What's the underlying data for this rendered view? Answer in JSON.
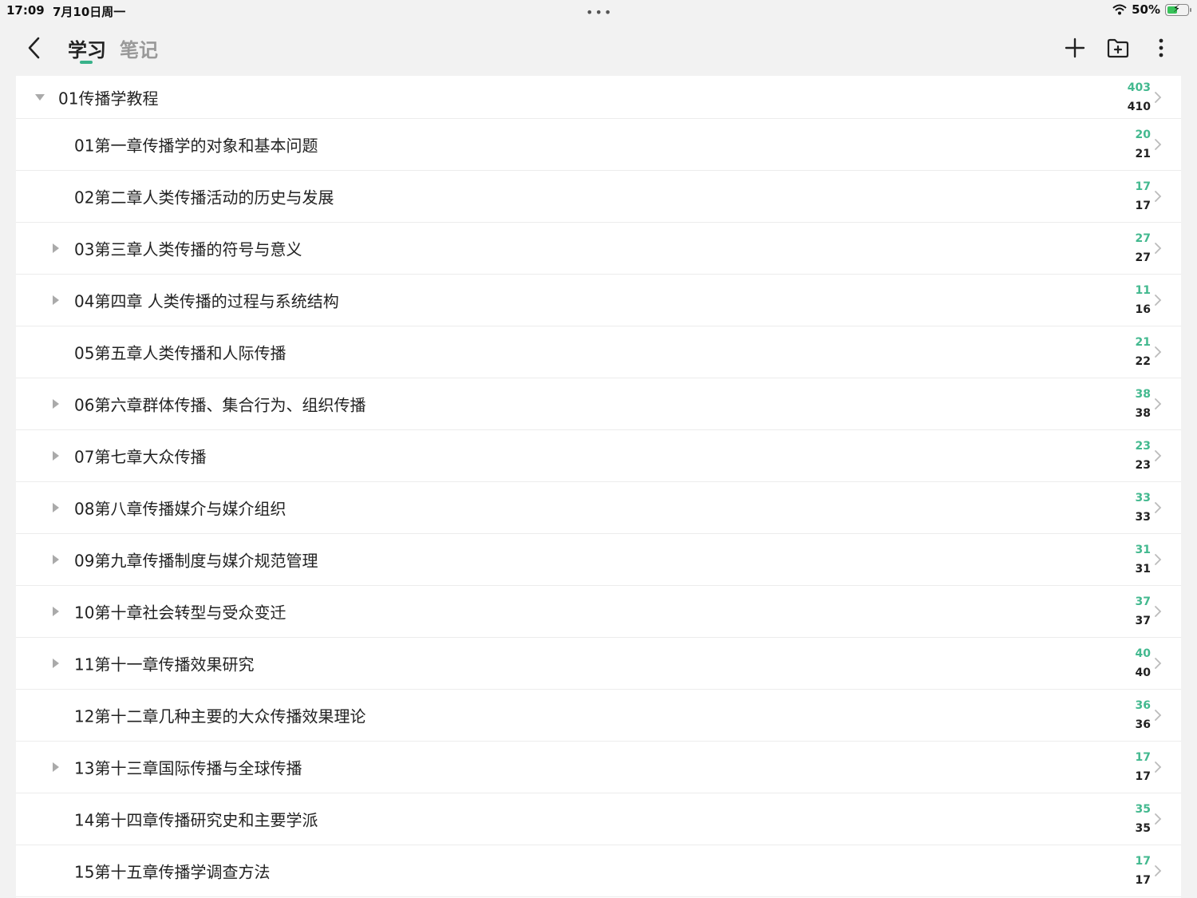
{
  "status_bar": {
    "time": "17:09",
    "date": "7月10日周一",
    "battery": "50%"
  },
  "nav": {
    "tabs": [
      {
        "label": "学习",
        "active": true
      },
      {
        "label": "笔记",
        "active": false
      }
    ],
    "accent_color": "#38b28a"
  },
  "root": {
    "title": "01传播学教程",
    "done": "403",
    "total": "410",
    "expanded": true
  },
  "chapters": [
    {
      "title": "01第一章传播学的对象和基本问题",
      "done": "20",
      "total": "21",
      "has_children": false
    },
    {
      "title": "02第二章人类传播活动的历史与发展",
      "done": "17",
      "total": "17",
      "has_children": false
    },
    {
      "title": "03第三章人类传播的符号与意义",
      "done": "27",
      "total": "27",
      "has_children": true
    },
    {
      "title": "04第四章 人类传播的过程与系统结构",
      "done": "11",
      "total": "16",
      "has_children": true
    },
    {
      "title": "05第五章人类传播和人际传播",
      "done": "21",
      "total": "22",
      "has_children": false
    },
    {
      "title": "06第六章群体传播、集合行为、组织传播",
      "done": "38",
      "total": "38",
      "has_children": true
    },
    {
      "title": "07第七章大众传播",
      "done": "23",
      "total": "23",
      "has_children": true
    },
    {
      "title": "08第八章传播媒介与媒介组织",
      "done": "33",
      "total": "33",
      "has_children": true
    },
    {
      "title": "09第九章传播制度与媒介规范管理",
      "done": "31",
      "total": "31",
      "has_children": true
    },
    {
      "title": "10第十章社会转型与受众变迁",
      "done": "37",
      "total": "37",
      "has_children": true
    },
    {
      "title": "11第十一章传播效果研究",
      "done": "40",
      "total": "40",
      "has_children": true
    },
    {
      "title": "12第十二章几种主要的大众传播效果理论",
      "done": "36",
      "total": "36",
      "has_children": false
    },
    {
      "title": "13第十三章国际传播与全球传播",
      "done": "17",
      "total": "17",
      "has_children": true
    },
    {
      "title": "14第十四章传播研究史和主要学派",
      "done": "35",
      "total": "35",
      "has_children": false
    },
    {
      "title": "15第十五章传播学调查方法",
      "done": "17",
      "total": "17",
      "has_children": false
    }
  ]
}
